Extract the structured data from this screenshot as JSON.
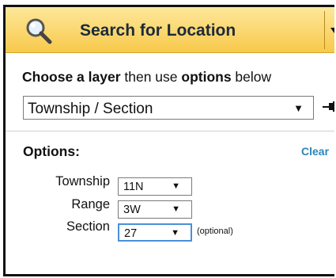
{
  "header": {
    "title": "Search for Location"
  },
  "prompt": {
    "part1": "Choose a layer",
    "part2": " then use ",
    "part3": "options",
    "part4": " below"
  },
  "layer": {
    "selected": "Township / Section"
  },
  "options": {
    "title": "Options:",
    "clear": "Clear",
    "township": {
      "label": "Township",
      "value": "11N"
    },
    "range": {
      "label": "Range",
      "value": "3W"
    },
    "section": {
      "label": "Section",
      "value": "27",
      "hint": "(optional)"
    }
  },
  "colors": {
    "header_gradient_top": "#fde79b",
    "header_gradient_bottom": "#f8c94a",
    "link": "#2a86b8",
    "focus": "#4a90d9"
  },
  "icons": {
    "header": "search-icon",
    "dropdown": "dropdown-arrow-icon",
    "pin": "pin-icon"
  }
}
